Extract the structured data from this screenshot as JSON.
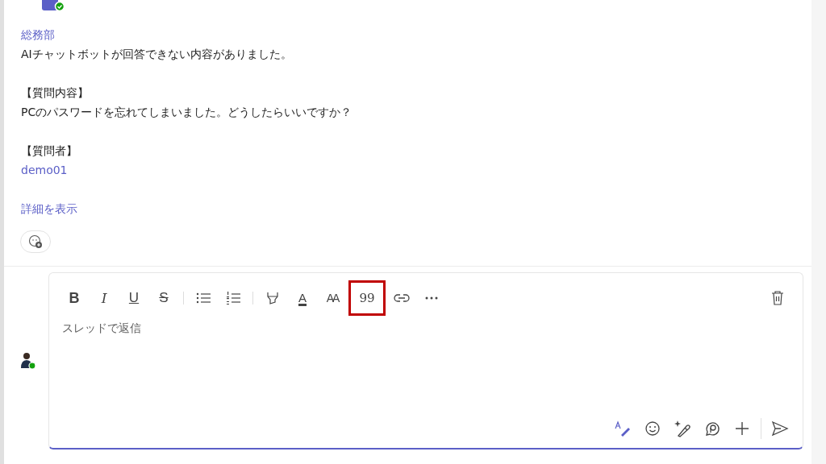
{
  "message": {
    "department": "総務部",
    "intro": "AIチャットボットが回答できない内容がありました。",
    "sections": [
      {
        "heading": "【質問内容】",
        "body": "PCのパスワードを忘れてしまいました。どうしたらいいですか？",
        "kind": "text"
      },
      {
        "heading": "【質問者】",
        "body": "demo01",
        "kind": "mention"
      }
    ],
    "details_link": "詳細を表示"
  },
  "composer": {
    "placeholder": "スレッドで返信",
    "toolbar": [
      {
        "kind": "bold",
        "label": "B",
        "highlighted": false
      },
      {
        "kind": "italic",
        "label": "I",
        "highlighted": false
      },
      {
        "kind": "underline",
        "label": "U",
        "highlighted": false
      },
      {
        "kind": "strike",
        "label": "S",
        "highlighted": false
      },
      {
        "kind": "bullets",
        "highlighted": false
      },
      {
        "kind": "numbers",
        "highlighted": false
      },
      {
        "kind": "highlight",
        "highlighted": false
      },
      {
        "kind": "fontcolor",
        "label": "A",
        "highlighted": false
      },
      {
        "kind": "fontsize",
        "label": "AA",
        "highlighted": false
      },
      {
        "kind": "quote",
        "label": "99",
        "highlighted": true
      },
      {
        "kind": "link",
        "highlighted": false
      },
      {
        "kind": "more",
        "highlighted": false
      }
    ],
    "actions": [
      {
        "kind": "format",
        "selected": true
      },
      {
        "kind": "emoji",
        "selected": false
      },
      {
        "kind": "sparkle",
        "selected": false
      },
      {
        "kind": "loop",
        "selected": false
      },
      {
        "kind": "plus",
        "selected": false
      },
      {
        "kind": "send",
        "selected": false
      }
    ]
  }
}
